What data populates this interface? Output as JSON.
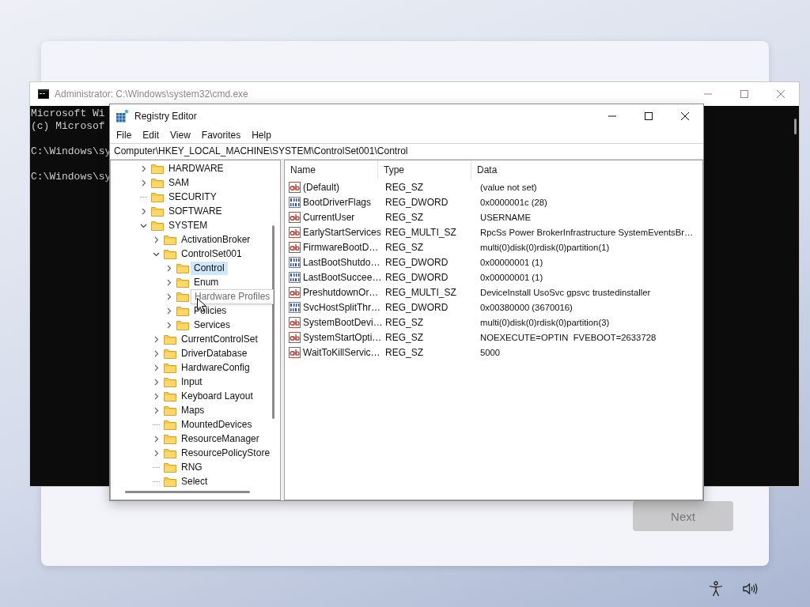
{
  "setup_dialog": {
    "next_button": {
      "label": "Next",
      "disabled": true
    }
  },
  "cmd_window": {
    "title": "Administrator: C:\\Windows\\system32\\cmd.exe",
    "active": false,
    "blocks": [
      [
        "Microsoft Wi",
        "(c) Microsof"
      ],
      [
        "C:\\Windows\\sy"
      ],
      [
        "C:\\Windows\\sy"
      ]
    ]
  },
  "registry_editor": {
    "title": "Registry Editor",
    "active": true,
    "menu": [
      "File",
      "Edit",
      "View",
      "Favorites",
      "Help"
    ],
    "address": "Computer\\HKEY_LOCAL_MACHINE\\SYSTEM\\ControlSet001\\Control",
    "tree": [
      {
        "label": "HARDWARE",
        "expandable": true,
        "expanded": false,
        "selected": false,
        "hovered": false
      },
      {
        "label": "SAM",
        "expandable": true,
        "expanded": false,
        "selected": false,
        "hovered": false
      },
      {
        "label": "SECURITY",
        "expandable": false,
        "selected": false,
        "hovered": false
      },
      {
        "label": "SOFTWARE",
        "expandable": true,
        "expanded": false,
        "selected": false,
        "hovered": false
      },
      {
        "label": "SYSTEM",
        "expandable": true,
        "expanded": true,
        "selected": false,
        "hovered": false,
        "children": [
          {
            "label": "ActivationBroker",
            "expandable": true,
            "expanded": false,
            "selected": false,
            "hovered": false
          },
          {
            "label": "ControlSet001",
            "expandable": true,
            "expanded": true,
            "selected": false,
            "hovered": false,
            "children": [
              {
                "label": "Control",
                "expandable": true,
                "expanded": false,
                "selected": true,
                "hovered": false
              },
              {
                "label": "Enum",
                "expandable": true,
                "expanded": false,
                "selected": false,
                "hovered": false
              },
              {
                "label": "Hardware Profiles",
                "expandable": true,
                "expanded": false,
                "selected": false,
                "hovered": true
              },
              {
                "label": "Policies",
                "expandable": true,
                "expanded": false,
                "selected": false,
                "hovered": false
              },
              {
                "label": "Services",
                "expandable": true,
                "expanded": false,
                "selected": false,
                "hovered": false
              }
            ]
          },
          {
            "label": "CurrentControlSet",
            "expandable": true,
            "expanded": false,
            "selected": false,
            "hovered": false
          },
          {
            "label": "DriverDatabase",
            "expandable": true,
            "expanded": false,
            "selected": false,
            "hovered": false
          },
          {
            "label": "HardwareConfig",
            "expandable": true,
            "expanded": false,
            "selected": false,
            "hovered": false
          },
          {
            "label": "Input",
            "expandable": true,
            "expanded": false,
            "selected": false,
            "hovered": false
          },
          {
            "label": "Keyboard Layout",
            "expandable": true,
            "expanded": false,
            "selected": false,
            "hovered": false
          },
          {
            "label": "Maps",
            "expandable": true,
            "expanded": false,
            "selected": false,
            "hovered": false
          },
          {
            "label": "MountedDevices",
            "expandable": false,
            "selected": false,
            "hovered": false
          },
          {
            "label": "ResourceManager",
            "expandable": true,
            "expanded": false,
            "selected": false,
            "hovered": false
          },
          {
            "label": "ResourcePolicyStore",
            "expandable": true,
            "expanded": false,
            "selected": false,
            "hovered": false
          },
          {
            "label": "RNG",
            "expandable": false,
            "selected": false,
            "hovered": false
          },
          {
            "label": "Select",
            "expandable": false,
            "selected": false,
            "hovered": false
          }
        ]
      }
    ],
    "columns": [
      "Name",
      "Type",
      "Data"
    ],
    "values": [
      {
        "kind": "string",
        "name": "(Default)",
        "type": "REG_SZ",
        "data": "(value not set)"
      },
      {
        "kind": "binary",
        "name": "BootDriverFlags",
        "type": "REG_DWORD",
        "data": "0x0000001c (28)"
      },
      {
        "kind": "string",
        "name": "CurrentUser",
        "type": "REG_SZ",
        "data": "USERNAME"
      },
      {
        "kind": "string",
        "name": "EarlyStartServices",
        "type": "REG_MULTI_SZ",
        "data": "RpcSs Power BrokerInfrastructure SystemEventsBr…"
      },
      {
        "kind": "string",
        "name": "FirmwareBootD…",
        "type": "REG_SZ",
        "data": "multi(0)disk(0)rdisk(0)partition(1)"
      },
      {
        "kind": "binary",
        "name": "LastBootShutdo…",
        "type": "REG_DWORD",
        "data": "0x00000001 (1)"
      },
      {
        "kind": "binary",
        "name": "LastBootSuccee…",
        "type": "REG_DWORD",
        "data": "0x00000001 (1)"
      },
      {
        "kind": "string",
        "name": "PreshutdownOr…",
        "type": "REG_MULTI_SZ",
        "data": "DeviceInstall UsoSvc gpsvc trustedinstaller"
      },
      {
        "kind": "binary",
        "name": "SvcHostSplitThr…",
        "type": "REG_DWORD",
        "data": "0x00380000 (3670016)"
      },
      {
        "kind": "string",
        "name": "SystemBootDevi…",
        "type": "REG_SZ",
        "data": "multi(0)disk(0)rdisk(0)partition(3)"
      },
      {
        "kind": "string",
        "name": "SystemStartOpti…",
        "type": "REG_SZ",
        "data": "NOEXECUTE=OPTIN  FVEBOOT=2633728"
      },
      {
        "kind": "string",
        "name": "WaitToKillServic…",
        "type": "REG_SZ",
        "data": "5000"
      }
    ]
  }
}
